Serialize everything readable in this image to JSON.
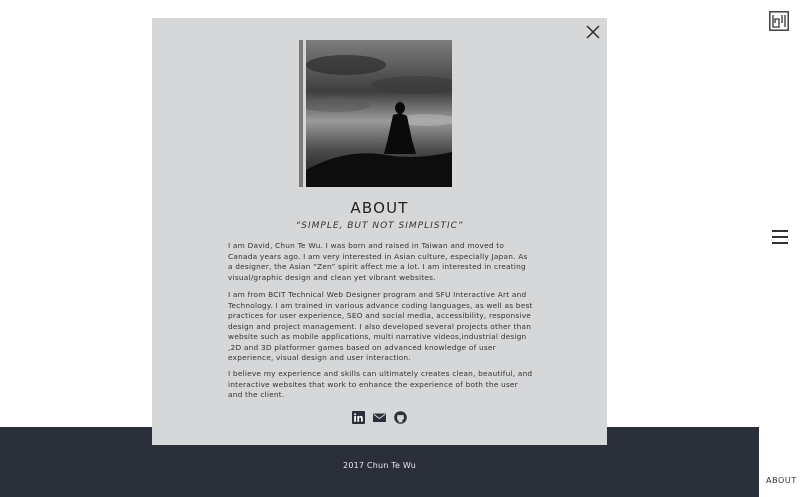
{
  "modal": {
    "title": "ABOUT",
    "tagline_open": "“",
    "tagline_text": "SIMPLE, BUT NOT SIMPLISTIC",
    "tagline_close": "”",
    "paragraphs": [
      "I am David, Chun Te Wu. I was born and raised in Taiwan and moved to Canada years ago. I am very interested in Asian culture, especially Japan. As a designer, the Asian “Zen” spirit affect me a lot. I am interested in creating visual/graphic design and clean yet vibrant websites.",
      "I am from BCIT Technical Web Designer program and SFU Interactive Art and Technology. I am trained in various advance coding languages, as well as best practices for user experience, SEO and social media, accessibility, responsive design and project management. I also developed several projects other than website such as mobile applications, multi narrative videos,industrial design ,2D and 3D platformer games based on advanced knowledge of user experience, visual design and user interaction.",
      "I believe my experience and skills can ultimately creates clean, beautiful, and interactive websites that work to enhance the experience of both the user and the client."
    ],
    "socials": [
      "linkedin-icon",
      "mail-icon",
      "github-icon"
    ]
  },
  "footer": {
    "text": "2017 Chun Te Wu"
  },
  "right_rail": {
    "label": "ABOUT"
  }
}
